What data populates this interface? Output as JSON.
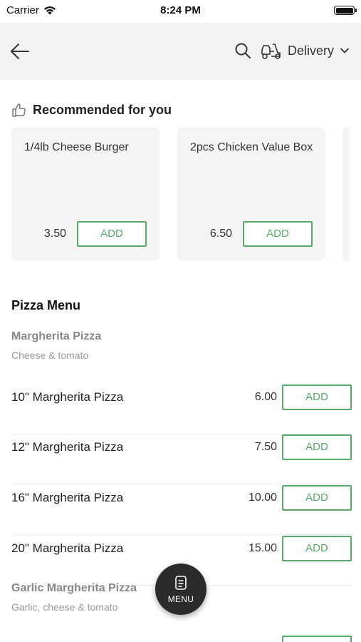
{
  "status_bar": {
    "carrier": "Carrier",
    "time": "8:24 PM"
  },
  "nav": {
    "delivery_label": "Delivery"
  },
  "recommended": {
    "title": "Recommended for you",
    "items": [
      {
        "name": "1/4lb Cheese Burger",
        "price": "3.50",
        "add_label": "ADD"
      },
      {
        "name": "2pcs Chicken Value Box",
        "price": "6.50",
        "add_label": "ADD"
      }
    ]
  },
  "menu": {
    "section_title": "Pizza Menu",
    "groups": [
      {
        "title": "Margherita Pizza",
        "subtitle": "Cheese & tomato",
        "items": [
          {
            "name": "10\" Margherita Pizza",
            "price": "6.00",
            "add_label": "ADD"
          },
          {
            "name": "12\" Margherita Pizza",
            "price": "7.50",
            "add_label": "ADD"
          },
          {
            "name": "16\" Margherita Pizza",
            "price": "10.00",
            "add_label": "ADD"
          },
          {
            "name": "20\" Margherita Pizza",
            "price": "15.00",
            "add_label": "ADD"
          }
        ]
      },
      {
        "title": "Garlic Margherita Pizza",
        "subtitle": "Garlic, cheese & tomato",
        "items": []
      }
    ]
  },
  "fab": {
    "label": "MENU"
  },
  "colors": {
    "accent": "#5aa86b",
    "nav_bg": "#f2f2f2",
    "card_bg": "#f4f4f4",
    "fab_bg": "#2b2b2b"
  }
}
